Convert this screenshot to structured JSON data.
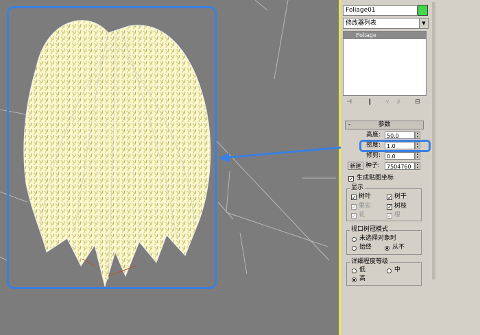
{
  "object": {
    "name": "Foliage01",
    "color": "#3fd94a"
  },
  "modifier_list": {
    "label": "修改器列表"
  },
  "stack": {
    "items": [
      "Foliage"
    ]
  },
  "params": {
    "title": "参数",
    "height_label": "高度:",
    "height_value": "50.0",
    "density_label": "密度:",
    "density_value": "1.0",
    "prune_label": "修剪:",
    "prune_value": "0.0",
    "new_button": "新建",
    "seed_label": "种子:",
    "seed_value": "7504760",
    "gen_map_label": "生成贴图坐标"
  },
  "display": {
    "title": "显示",
    "leaves": "树叶",
    "trunk": "树干",
    "fruit": "果实",
    "branches": "树枝",
    "flowers": "花",
    "roots": "根"
  },
  "canopy": {
    "title": "视口树冠模式",
    "when_not_selected": "未选择对象时",
    "always": "始终",
    "never": "从不"
  },
  "lod": {
    "title": "详细程度等级",
    "low": "低",
    "medium": "中",
    "high": "高"
  },
  "colors": {
    "highlight": "#3b7fe0",
    "viewport": "#7c7c7c",
    "foliage": "#f4f0a0"
  }
}
